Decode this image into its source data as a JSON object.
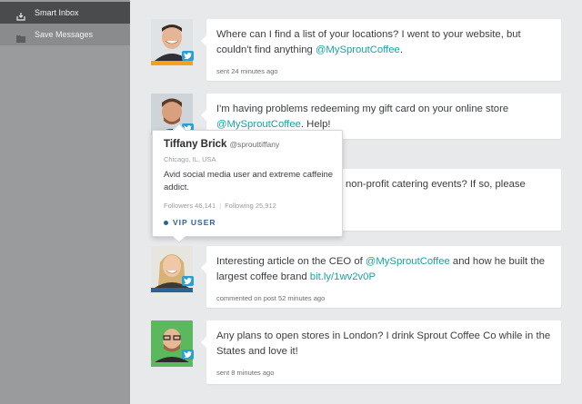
{
  "sidebar": {
    "items": [
      {
        "label": "Smart Inbox",
        "icon": "inbox-icon",
        "active": true
      },
      {
        "label": "Save Messages",
        "icon": "folder-icon",
        "active": false
      }
    ]
  },
  "messages": [
    {
      "text_before": "Where can I find a list of your locations? I went to your website, but couldn't find anything ",
      "mention": "@MySproutCoffee",
      "text_after": ".",
      "meta": "sent 24 minutes ago",
      "bar_color": "#f4a21e"
    },
    {
      "text_before": "I'm having problems redeeming my gift card on your online store ",
      "mention": "@MySproutCoffee",
      "text_after": ". Help!",
      "meta": "",
      "bar_color": "#2a6496"
    },
    {
      "text_before": "non-profit catering events? If so, please",
      "mention": "",
      "text_after": "",
      "meta": "",
      "bar_color": ""
    },
    {
      "text_before": "Interesting article on the CEO of ",
      "mention": "@MySproutCoffee",
      "text_mid": " and how he built the largest coffee brand ",
      "link": "bit.ly/1wv2v0P",
      "meta": "commented on post 52 minutes ago",
      "bar_color": "#2a6496"
    },
    {
      "text_before": "Any plans to open stores in London? I drink Sprout Coffee Co while in the States and love it!",
      "meta": "sent 8 minutes ago",
      "bar_color": "#5cb85c"
    }
  ],
  "profile": {
    "name": "Tiffany Brick",
    "handle": "@sprouttiffany",
    "location": "Chicago, IL, USA",
    "bio": "Avid social media user and extreme caffeine addict.",
    "followers": "Followers 46,141",
    "separator": "|",
    "following": "Following 25,912",
    "badge": "VIP USER"
  },
  "colors": {
    "accent": "#18a3a3",
    "twitter": "#2a9fd6",
    "vip": "#2a6496"
  }
}
